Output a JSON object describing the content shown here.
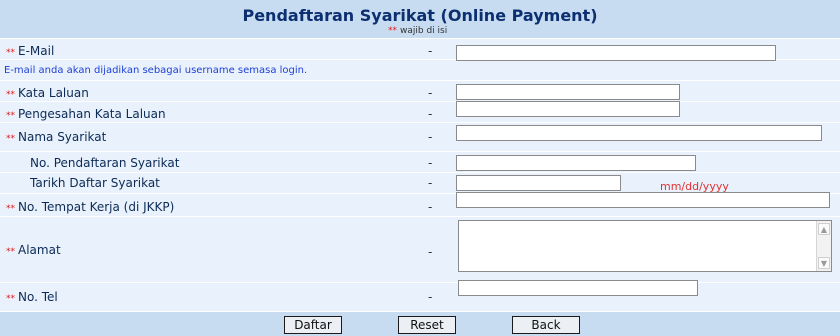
{
  "form": {
    "title": "Pendaftaran Syarikat (Online Payment)",
    "required_marker": "**",
    "required_note": "wajib di isi",
    "separator": "-",
    "email_hint": "E-mail anda akan dijadikan sebagai username semasa login.",
    "date_format_hint": "mm/dd/yyyy"
  },
  "fields": {
    "email": {
      "label": "E-Mail",
      "value": ""
    },
    "password": {
      "label": "Kata Laluan",
      "value": ""
    },
    "confirm_password": {
      "label": "Pengesahan Kata Laluan",
      "value": ""
    },
    "company_name": {
      "label": "Nama Syarikat",
      "value": ""
    },
    "company_reg_no": {
      "label": "No. Pendaftaran Syarikat",
      "value": ""
    },
    "company_reg_date": {
      "label": "Tarikh Daftar Syarikat",
      "value": ""
    },
    "workplace_no": {
      "label": "No. Tempat Kerja (di JKKP)",
      "value": ""
    },
    "address": {
      "label": "Alamat",
      "value": ""
    },
    "phone": {
      "label": "No. Tel",
      "value": ""
    }
  },
  "buttons": {
    "submit": "Daftar",
    "reset": "Reset",
    "back": "Back"
  }
}
